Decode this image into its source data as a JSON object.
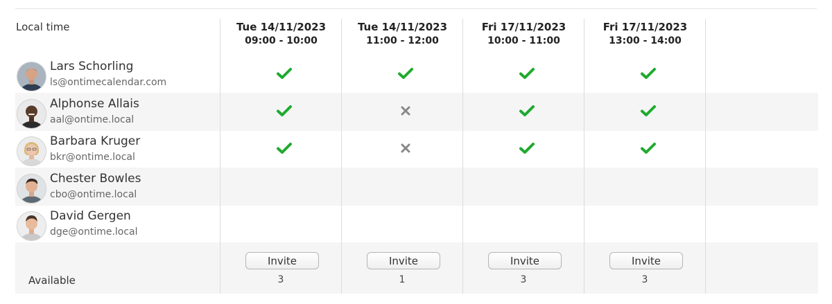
{
  "header": {
    "local_time_label": "Local time"
  },
  "slots": [
    {
      "date": "Tue 14/11/2023",
      "time": "09:00 - 10:00",
      "available": "3",
      "invite_label": "Invite"
    },
    {
      "date": "Tue 14/11/2023",
      "time": "11:00 - 12:00",
      "available": "1",
      "invite_label": "Invite"
    },
    {
      "date": "Fri 17/11/2023",
      "time": "10:00 - 11:00",
      "available": "3",
      "invite_label": "Invite"
    },
    {
      "date": "Fri 17/11/2023",
      "time": "13:00 - 14:00",
      "available": "3",
      "invite_label": "Invite"
    }
  ],
  "people": [
    {
      "name": "Lars Schorling",
      "email": "ls@ontimecalendar.com",
      "availability": [
        "yes",
        "yes",
        "yes",
        "yes"
      ]
    },
    {
      "name": "Alphonse Allais",
      "email": "aal@ontime.local",
      "availability": [
        "yes",
        "no",
        "yes",
        "yes"
      ]
    },
    {
      "name": "Barbara Kruger",
      "email": "bkr@ontime.local",
      "availability": [
        "yes",
        "no",
        "yes",
        "yes"
      ]
    },
    {
      "name": "Chester Bowles",
      "email": "cbo@ontime.local",
      "availability": [
        "",
        "",
        "",
        ""
      ]
    },
    {
      "name": "David Gergen",
      "email": "dge@ontime.local",
      "availability": [
        "",
        "",
        "",
        ""
      ]
    }
  ],
  "footer": {
    "available_label": "Available"
  },
  "colors": {
    "check": "#1faa2e",
    "cross": "#888888",
    "alt_row": "#f5f5f5"
  },
  "icons": {
    "yes": "checkmark-icon",
    "no": "cross-icon"
  }
}
